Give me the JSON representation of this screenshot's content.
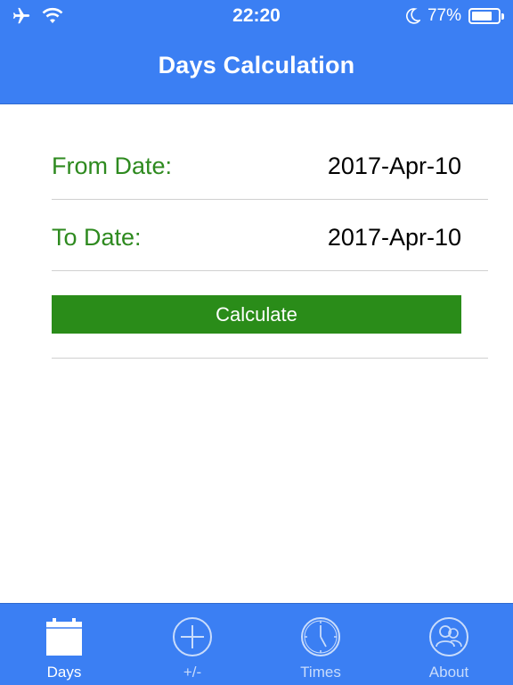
{
  "status_bar": {
    "time": "22:20",
    "battery_percent": "77%",
    "battery_level": 0.77,
    "icons": [
      "airplane-icon",
      "wifi-icon",
      "moon-icon",
      "battery-icon"
    ]
  },
  "header": {
    "title": "Days Calculation"
  },
  "form": {
    "from": {
      "label": "From Date:",
      "value": "2017-Apr-10"
    },
    "to": {
      "label": "To Date:",
      "value": "2017-Apr-10"
    },
    "calculate_label": "Calculate"
  },
  "tabs": [
    {
      "label": "Days",
      "icon": "calendar-icon",
      "active": true
    },
    {
      "label": "+/-",
      "icon": "plus-circle-icon",
      "active": false
    },
    {
      "label": "Times",
      "icon": "clock-icon",
      "active": false
    },
    {
      "label": "About",
      "icon": "people-icon",
      "active": false
    }
  ],
  "colors": {
    "accent_blue": "#3b7ff3",
    "label_green": "#2e8a1f",
    "button_green": "#2a8c19"
  }
}
